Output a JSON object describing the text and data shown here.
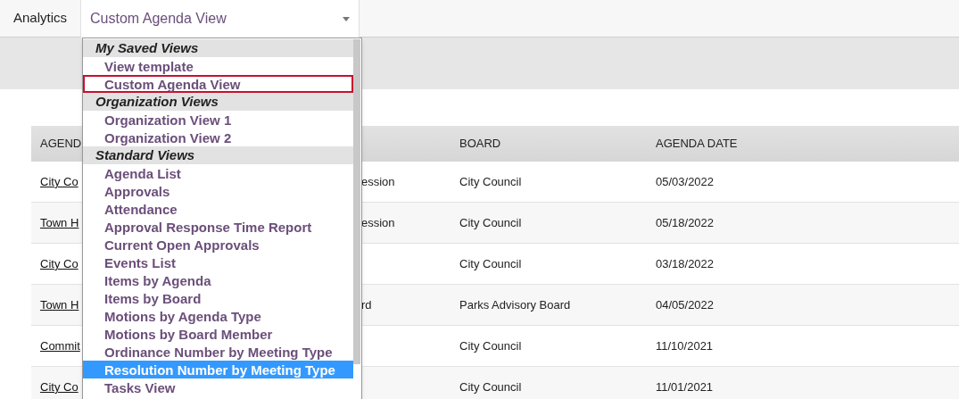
{
  "toolbar": {
    "label": "Analytics",
    "view_select": {
      "value": "Custom Agenda View"
    }
  },
  "view_menu": {
    "groups": [
      {
        "title": "My Saved Views",
        "items": [
          {
            "label": "View template",
            "selected": false,
            "outlined": false
          },
          {
            "label": "Custom Agenda View",
            "selected": false,
            "outlined": true
          }
        ]
      },
      {
        "title": "Organization Views",
        "items": [
          {
            "label": "Organization View 1",
            "selected": false,
            "outlined": false
          },
          {
            "label": "Organization View 2",
            "selected": false,
            "outlined": false
          }
        ]
      },
      {
        "title": "Standard Views",
        "items": [
          {
            "label": "Agenda List",
            "selected": false,
            "outlined": false
          },
          {
            "label": "Approvals",
            "selected": false,
            "outlined": false
          },
          {
            "label": "Attendance",
            "selected": false,
            "outlined": false
          },
          {
            "label": "Approval Response Time Report",
            "selected": false,
            "outlined": false
          },
          {
            "label": "Current Open Approvals",
            "selected": false,
            "outlined": false
          },
          {
            "label": "Events List",
            "selected": false,
            "outlined": false
          },
          {
            "label": "Items by Agenda",
            "selected": false,
            "outlined": false
          },
          {
            "label": "Items by Board",
            "selected": false,
            "outlined": false
          },
          {
            "label": "Motions by Agenda Type",
            "selected": false,
            "outlined": false
          },
          {
            "label": "Motions by Board Member",
            "selected": false,
            "outlined": false
          },
          {
            "label": "Ordinance Number by Meeting Type",
            "selected": false,
            "outlined": false
          },
          {
            "label": "Resolution Number by Meeting Type",
            "selected": true,
            "outlined": false
          },
          {
            "label": "Tasks View",
            "selected": false,
            "outlined": false
          }
        ]
      }
    ]
  },
  "table": {
    "columns": [
      "AGEND",
      null,
      "BOARD",
      "AGENDA DATE"
    ],
    "rows": [
      [
        "City Co",
        "ession",
        "City Council",
        "05/03/2022"
      ],
      [
        "Town H",
        "ession",
        "City Council",
        "05/18/2022"
      ],
      [
        "City Co",
        null,
        "City Council",
        "03/18/2022"
      ],
      [
        "Town H",
        "rd",
        "Parks Advisory Board",
        "04/05/2022"
      ],
      [
        "Commit",
        null,
        "City Council",
        "11/10/2021"
      ],
      [
        "City Co",
        null,
        "City Council",
        "11/01/2021"
      ]
    ]
  }
}
